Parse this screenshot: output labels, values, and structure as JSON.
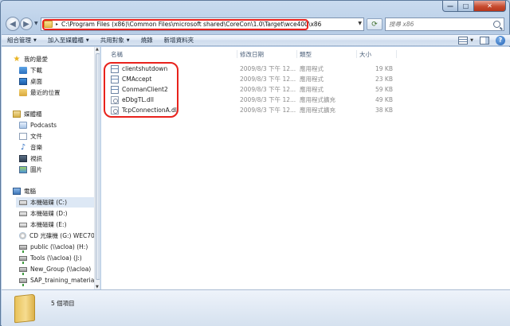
{
  "window": {
    "min_glyph": "—",
    "max_glyph": "□",
    "close_glyph": "✕"
  },
  "address": {
    "path": "C:\\Program Files (x86)\\Common Files\\microsoft shared\\CoreCon\\1.0\\Target\\wce400\\x86"
  },
  "search": {
    "placeholder": "搜尋 x86"
  },
  "toolbar": {
    "organize": "組合管理",
    "include_in_library": "加入至媒體櫃",
    "share_with": "共用對象",
    "burn": "燒錄",
    "new_folder": "新增資料夾"
  },
  "nav": {
    "favorites": {
      "label": "我的最愛",
      "items": [
        "下載",
        "桌面",
        "最近的位置"
      ]
    },
    "libraries": {
      "label": "媒體櫃",
      "items": [
        "Podcasts",
        "文件",
        "音樂",
        "視訊",
        "圖片"
      ]
    },
    "computer": {
      "label": "電腦",
      "items": [
        "本機磁碟 (C:)",
        "本機磁碟 (D:)",
        "本機磁碟 (E:)",
        "CD 光碟機 (G:) WEC70",
        "public (\\\\acloa) (H:)",
        "Tools (\\\\acloa) (J:)",
        "New_Group (\\\\acloa)",
        "SAP_training_material"
      ]
    }
  },
  "columns": {
    "name": "名稱",
    "date": "修改日期",
    "type": "類型",
    "size": "大小"
  },
  "files": [
    {
      "name": "clientshutdown",
      "date": "2009/8/3 下午 12...",
      "type": "應用程式",
      "size": "19 KB",
      "kind": "exe"
    },
    {
      "name": "CMAccept",
      "date": "2009/8/3 下午 12...",
      "type": "應用程式",
      "size": "23 KB",
      "kind": "exe"
    },
    {
      "name": "ConmanClient2",
      "date": "2009/8/3 下午 12...",
      "type": "應用程式",
      "size": "59 KB",
      "kind": "exe"
    },
    {
      "name": "eDbgTL.dll",
      "date": "2009/8/3 下午 12...",
      "type": "應用程式擴充",
      "size": "49 KB",
      "kind": "dll"
    },
    {
      "name": "TcpConnectionA.dll",
      "date": "2009/8/3 下午 12...",
      "type": "應用程式擴充",
      "size": "38 KB",
      "kind": "dll"
    }
  ],
  "status": {
    "item_count": "5 個項目"
  }
}
